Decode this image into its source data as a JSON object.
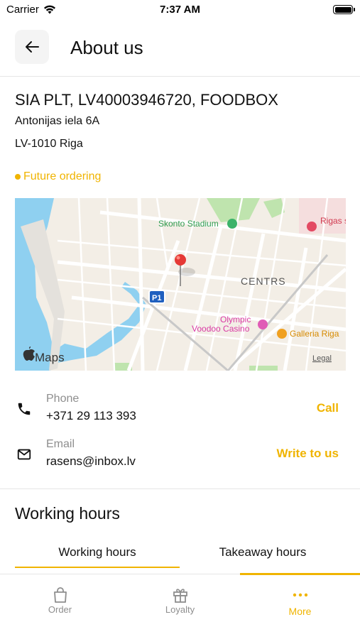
{
  "status_bar": {
    "carrier": "Carrier",
    "time": "7:37 AM"
  },
  "header": {
    "title": "About us",
    "back_icon": "arrow-left-icon"
  },
  "company": {
    "name": "SIA PLT, LV40003946720, FOODBOX",
    "address_line1": "Antonijas iela 6A",
    "address_line2": "LV-1010 Riga",
    "future_ordering": "Future ordering"
  },
  "map": {
    "labels": {
      "stadium": "Skonto Stadium",
      "district": "CENTRS",
      "hospital": "Rigas slimnic",
      "casino_line1": "Olympic",
      "casino_line2": "Voodoo Casino",
      "gallery": "Galleria Riga",
      "route": "P1",
      "brand": "Maps",
      "legal": "Legal"
    },
    "colors": {
      "water": "#8fd0f0",
      "park": "#bfe4ae",
      "road": "#ffffff",
      "land": "#f3eee6",
      "pin": "#e53935"
    }
  },
  "contacts": [
    {
      "label": "Phone",
      "value": "+371 29 113 393",
      "action": "Call",
      "icon": "phone-icon"
    },
    {
      "label": "Email",
      "value": "rasens@inbox.lv",
      "action": "Write to us",
      "icon": "mail-icon"
    }
  ],
  "working_hours": {
    "title": "Working hours",
    "tabs": [
      {
        "label": "Working hours",
        "active": true
      },
      {
        "label": "Takeaway hours",
        "active": false
      }
    ]
  },
  "tabbar": {
    "items": [
      {
        "label": "Order",
        "icon": "shopping-bag-icon",
        "active": false
      },
      {
        "label": "Loyalty",
        "icon": "gift-icon",
        "active": false
      },
      {
        "label": "More",
        "icon": "more-dots-icon",
        "active": true
      }
    ]
  },
  "colors": {
    "accent": "#f0b400",
    "muted": "#8e8e8e",
    "text": "#111111"
  }
}
